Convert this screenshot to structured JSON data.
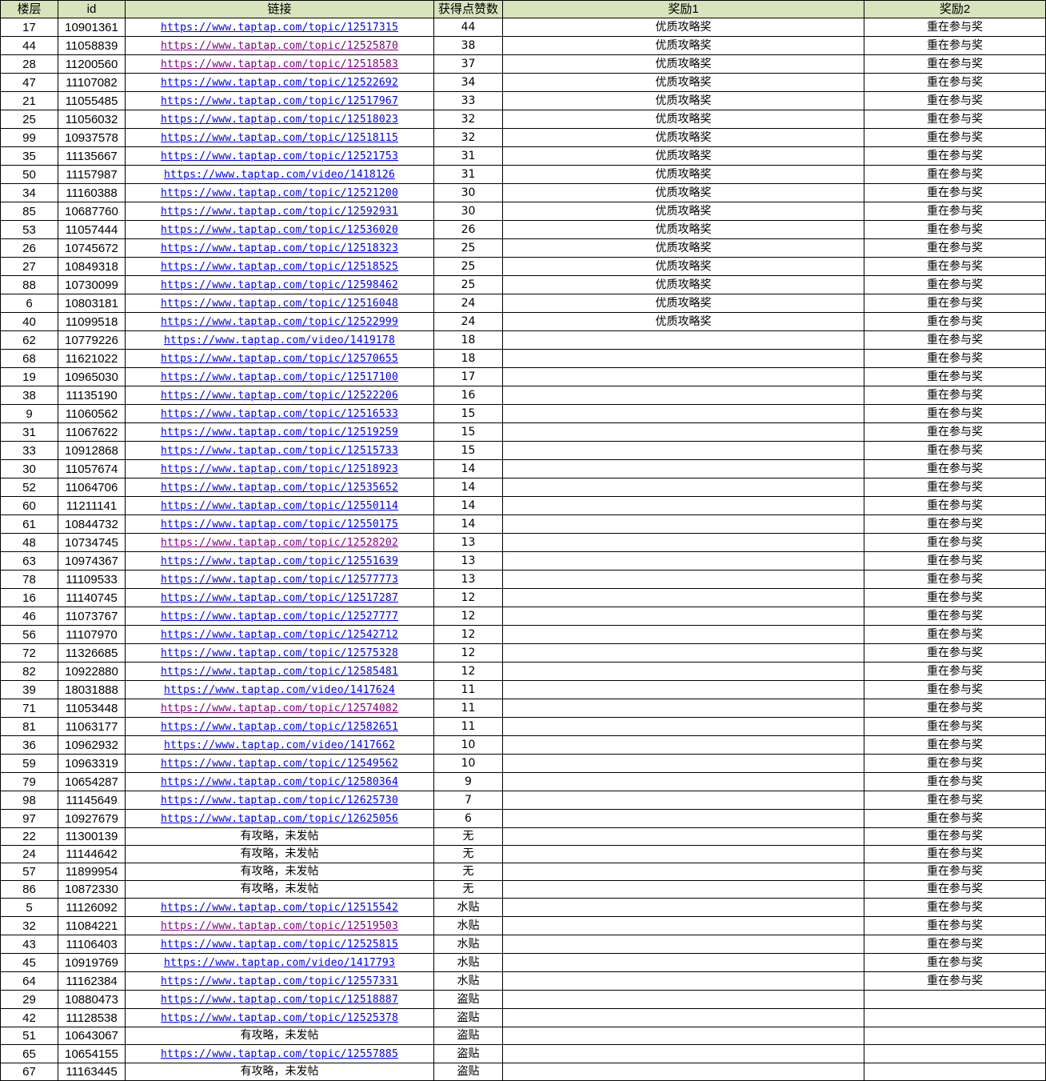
{
  "table": {
    "columns": [
      "楼层",
      "id",
      "链接",
      "获得点赞数",
      "奖励1",
      "奖励2"
    ],
    "rows": [
      {
        "floor": "17",
        "id": "10901361",
        "link": "https://www.taptap.com/topic/12517315",
        "likes": "44",
        "reward1": "优质攻略奖",
        "reward2": "重在参与奖",
        "visited": false
      },
      {
        "floor": "44",
        "id": "11058839",
        "link": "https://www.taptap.com/topic/12525870",
        "likes": "38",
        "reward1": "优质攻略奖",
        "reward2": "重在参与奖",
        "visited": true
      },
      {
        "floor": "28",
        "id": "11200560",
        "link": "https://www.taptap.com/topic/12518583",
        "likes": "37",
        "reward1": "优质攻略奖",
        "reward2": "重在参与奖",
        "visited": true
      },
      {
        "floor": "47",
        "id": "11107082",
        "link": "https://www.taptap.com/topic/12522692",
        "likes": "34",
        "reward1": "优质攻略奖",
        "reward2": "重在参与奖",
        "visited": false
      },
      {
        "floor": "21",
        "id": "11055485",
        "link": "https://www.taptap.com/topic/12517967",
        "likes": "33",
        "reward1": "优质攻略奖",
        "reward2": "重在参与奖",
        "visited": false
      },
      {
        "floor": "25",
        "id": "11056032",
        "link": "https://www.taptap.com/topic/12518023",
        "likes": "32",
        "reward1": "优质攻略奖",
        "reward2": "重在参与奖",
        "visited": false
      },
      {
        "floor": "99",
        "id": "10937578",
        "link": "https://www.taptap.com/topic/12518115",
        "likes": "32",
        "reward1": "优质攻略奖",
        "reward2": "重在参与奖",
        "visited": false
      },
      {
        "floor": "35",
        "id": "11135667",
        "link": "https://www.taptap.com/topic/12521753",
        "likes": "31",
        "reward1": "优质攻略奖",
        "reward2": "重在参与奖",
        "visited": false
      },
      {
        "floor": "50",
        "id": "11157987",
        "link": "https://www.taptap.com/video/1418126",
        "likes": "31",
        "reward1": "优质攻略奖",
        "reward2": "重在参与奖",
        "visited": false
      },
      {
        "floor": "34",
        "id": "11160388",
        "link": "https://www.taptap.com/topic/12521200",
        "likes": "30",
        "reward1": "优质攻略奖",
        "reward2": "重在参与奖",
        "visited": false
      },
      {
        "floor": "85",
        "id": "10687760",
        "link": "https://www.taptap.com/topic/12592931",
        "likes": "30",
        "reward1": "优质攻略奖",
        "reward2": "重在参与奖",
        "visited": false
      },
      {
        "floor": "53",
        "id": "11057444",
        "link": "https://www.taptap.com/topic/12536020",
        "likes": "26",
        "reward1": "优质攻略奖",
        "reward2": "重在参与奖",
        "visited": false
      },
      {
        "floor": "26",
        "id": "10745672",
        "link": "https://www.taptap.com/topic/12518323",
        "likes": "25",
        "reward1": "优质攻略奖",
        "reward2": "重在参与奖",
        "visited": false
      },
      {
        "floor": "27",
        "id": "10849318",
        "link": "https://www.taptap.com/topic/12518525",
        "likes": "25",
        "reward1": "优质攻略奖",
        "reward2": "重在参与奖",
        "visited": false
      },
      {
        "floor": "88",
        "id": "10730099",
        "link": "https://www.taptap.com/topic/12598462",
        "likes": "25",
        "reward1": "优质攻略奖",
        "reward2": "重在参与奖",
        "visited": false
      },
      {
        "floor": "6",
        "id": "10803181",
        "link": "https://www.taptap.com/topic/12516048",
        "likes": "24",
        "reward1": "优质攻略奖",
        "reward2": "重在参与奖",
        "visited": false
      },
      {
        "floor": "40",
        "id": "11099518",
        "link": "https://www.taptap.com/topic/12522999",
        "likes": "24",
        "reward1": "优质攻略奖",
        "reward2": "重在参与奖",
        "visited": false
      },
      {
        "floor": "62",
        "id": "10779226",
        "link": "https://www.taptap.com/video/1419178",
        "likes": "18",
        "reward1": "",
        "reward2": "重在参与奖",
        "visited": false
      },
      {
        "floor": "68",
        "id": "11621022",
        "link": "https://www.taptap.com/topic/12570655",
        "likes": "18",
        "reward1": "",
        "reward2": "重在参与奖",
        "visited": false
      },
      {
        "floor": "19",
        "id": "10965030",
        "link": "https://www.taptap.com/topic/12517100",
        "likes": "17",
        "reward1": "",
        "reward2": "重在参与奖",
        "visited": false
      },
      {
        "floor": "38",
        "id": "11135190",
        "link": "https://www.taptap.com/topic/12522206",
        "likes": "16",
        "reward1": "",
        "reward2": "重在参与奖",
        "visited": false
      },
      {
        "floor": "9",
        "id": "11060562",
        "link": "https://www.taptap.com/topic/12516533",
        "likes": "15",
        "reward1": "",
        "reward2": "重在参与奖",
        "visited": false
      },
      {
        "floor": "31",
        "id": "11067622",
        "link": "https://www.taptap.com/topic/12519259",
        "likes": "15",
        "reward1": "",
        "reward2": "重在参与奖",
        "visited": false
      },
      {
        "floor": "33",
        "id": "10912868",
        "link": "https://www.taptap.com/topic/12515733",
        "likes": "15",
        "reward1": "",
        "reward2": "重在参与奖",
        "visited": false
      },
      {
        "floor": "30",
        "id": "11057674",
        "link": "https://www.taptap.com/topic/12518923",
        "likes": "14",
        "reward1": "",
        "reward2": "重在参与奖",
        "visited": false
      },
      {
        "floor": "52",
        "id": "11064706",
        "link": "https://www.taptap.com/topic/12535652",
        "likes": "14",
        "reward1": "",
        "reward2": "重在参与奖",
        "visited": false
      },
      {
        "floor": "60",
        "id": "11211141",
        "link": "https://www.taptap.com/topic/12550114",
        "likes": "14",
        "reward1": "",
        "reward2": "重在参与奖",
        "visited": false
      },
      {
        "floor": "61",
        "id": "10844732",
        "link": "https://www.taptap.com/topic/12550175",
        "likes": "14",
        "reward1": "",
        "reward2": "重在参与奖",
        "visited": false
      },
      {
        "floor": "48",
        "id": "10734745",
        "link": "https://www.taptap.com/topic/12528202",
        "likes": "13",
        "reward1": "",
        "reward2": "重在参与奖",
        "visited": true
      },
      {
        "floor": "63",
        "id": "10974367",
        "link": "https://www.taptap.com/topic/12551639",
        "likes": "13",
        "reward1": "",
        "reward2": "重在参与奖",
        "visited": false
      },
      {
        "floor": "78",
        "id": "11109533",
        "link": "https://www.taptap.com/topic/12577773",
        "likes": "13",
        "reward1": "",
        "reward2": "重在参与奖",
        "visited": false
      },
      {
        "floor": "16",
        "id": "11140745",
        "link": "https://www.taptap.com/topic/12517287",
        "likes": "12",
        "reward1": "",
        "reward2": "重在参与奖",
        "visited": false
      },
      {
        "floor": "46",
        "id": "11073767",
        "link": "https://www.taptap.com/topic/12527777",
        "likes": "12",
        "reward1": "",
        "reward2": "重在参与奖",
        "visited": false
      },
      {
        "floor": "56",
        "id": "11107970",
        "link": "https://www.taptap.com/topic/12542712",
        "likes": "12",
        "reward1": "",
        "reward2": "重在参与奖",
        "visited": false
      },
      {
        "floor": "72",
        "id": "11326685",
        "link": "https://www.taptap.com/topic/12575328",
        "likes": "12",
        "reward1": "",
        "reward2": "重在参与奖",
        "visited": false
      },
      {
        "floor": "82",
        "id": "10922880",
        "link": "https://www.taptap.com/topic/12585481",
        "likes": "12",
        "reward1": "",
        "reward2": "重在参与奖",
        "visited": false
      },
      {
        "floor": "39",
        "id": "18031888",
        "link": "https://www.taptap.com/video/1417624",
        "likes": "11",
        "reward1": "",
        "reward2": "重在参与奖",
        "visited": false
      },
      {
        "floor": "71",
        "id": "11053448",
        "link": "https://www.taptap.com/topic/12574082",
        "likes": "11",
        "reward1": "",
        "reward2": "重在参与奖",
        "visited": true
      },
      {
        "floor": "81",
        "id": "11063177",
        "link": "https://www.taptap.com/topic/12582651",
        "likes": "11",
        "reward1": "",
        "reward2": "重在参与奖",
        "visited": false
      },
      {
        "floor": "36",
        "id": "10962932",
        "link": "https://www.taptap.com/video/1417662",
        "likes": "10",
        "reward1": "",
        "reward2": "重在参与奖",
        "visited": false
      },
      {
        "floor": "59",
        "id": "10963319",
        "link": "https://www.taptap.com/topic/12549562",
        "likes": "10",
        "reward1": "",
        "reward2": "重在参与奖",
        "visited": false
      },
      {
        "floor": "79",
        "id": "10654287",
        "link": "https://www.taptap.com/topic/12580364",
        "likes": "9",
        "reward1": "",
        "reward2": "重在参与奖",
        "visited": false
      },
      {
        "floor": "98",
        "id": "11145649",
        "link": "https://www.taptap.com/topic/12625730",
        "likes": "7",
        "reward1": "",
        "reward2": "重在参与奖",
        "visited": false
      },
      {
        "floor": "97",
        "id": "10927679",
        "link": "https://www.taptap.com/topic/12625056",
        "likes": "6",
        "reward1": "",
        "reward2": "重在参与奖",
        "visited": false
      },
      {
        "floor": "22",
        "id": "11300139",
        "link": "",
        "note": "有攻略，未发帖",
        "likes": "无",
        "reward1": "",
        "reward2": "重在参与奖",
        "visited": false
      },
      {
        "floor": "24",
        "id": "11144642",
        "link": "",
        "note": "有攻略，未发帖",
        "likes": "无",
        "reward1": "",
        "reward2": "重在参与奖",
        "visited": false
      },
      {
        "floor": "57",
        "id": "11899954",
        "link": "",
        "note": "有攻略，未发帖",
        "likes": "无",
        "reward1": "",
        "reward2": "重在参与奖",
        "visited": false
      },
      {
        "floor": "86",
        "id": "10872330",
        "link": "",
        "note": "有攻略，未发帖",
        "likes": "无",
        "reward1": "",
        "reward2": "重在参与奖",
        "visited": false
      },
      {
        "floor": "5",
        "id": "11126092",
        "link": "https://www.taptap.com/topic/12515542",
        "likes": "水贴",
        "reward1": "",
        "reward2": "重在参与奖",
        "visited": false
      },
      {
        "floor": "32",
        "id": "11084221",
        "link": "https://www.taptap.com/topic/12519503",
        "likes": "水贴",
        "reward1": "",
        "reward2": "重在参与奖",
        "visited": true
      },
      {
        "floor": "43",
        "id": "11106403",
        "link": "https://www.taptap.com/topic/12525815",
        "likes": "水贴",
        "reward1": "",
        "reward2": "重在参与奖",
        "visited": false
      },
      {
        "floor": "45",
        "id": "10919769",
        "link": "https://www.taptap.com/video/1417793",
        "likes": "水贴",
        "reward1": "",
        "reward2": "重在参与奖",
        "visited": false
      },
      {
        "floor": "64",
        "id": "11162384",
        "link": "https://www.taptap.com/topic/12557331",
        "likes": "水贴",
        "reward1": "",
        "reward2": "重在参与奖",
        "visited": false
      },
      {
        "floor": "29",
        "id": "10880473",
        "link": "https://www.taptap.com/topic/12518887",
        "likes": "盗贴",
        "reward1": "",
        "reward2": "",
        "visited": false
      },
      {
        "floor": "42",
        "id": "11128538",
        "link": "https://www.taptap.com/topic/12525378",
        "likes": "盗贴",
        "reward1": "",
        "reward2": "",
        "visited": false
      },
      {
        "floor": "51",
        "id": "10643067",
        "link": "",
        "note": "有攻略，未发帖",
        "likes": "盗贴",
        "reward1": "",
        "reward2": "",
        "visited": false
      },
      {
        "floor": "65",
        "id": "10654155",
        "link": "https://www.taptap.com/topic/12557885",
        "likes": "盗贴",
        "reward1": "",
        "reward2": "",
        "visited": false
      },
      {
        "floor": "67",
        "id": "11163445",
        "link": "",
        "note": "有攻略，未发帖",
        "likes": "盗贴",
        "reward1": "",
        "reward2": "",
        "visited": false
      }
    ]
  }
}
